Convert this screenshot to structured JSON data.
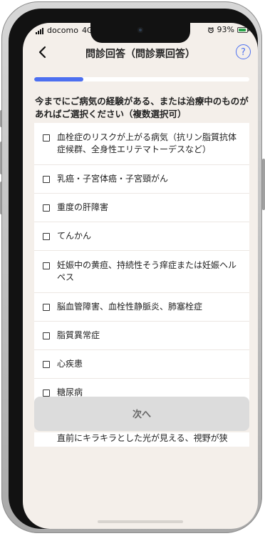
{
  "status_bar": {
    "carrier": "docomo",
    "network": "4G",
    "battery": "93%",
    "battery_level": 0.93,
    "alarm_icon": "alarm-icon"
  },
  "header": {
    "title": "問診回答（問診票回答）",
    "back_icon": "chevron-left-icon",
    "help_label": "?"
  },
  "progress": {
    "value": 0.23
  },
  "question": {
    "text": "今までにご病気の経験がある、または治療中のものがあればご選択ください（複数選択可）"
  },
  "options": [
    "血栓症のリスクが上がる病気（抗リン脂質抗体症候群、全身性エリテマトーデスなど）",
    "乳癌・子宮体癌・子宮頸がん",
    "重度の肝障害",
    "てんかん",
    "妊娠中の黄疸、持続性そう痒症または妊娠ヘルペス",
    "脳血管障害、血栓性静脈炎、肺塞栓症",
    "脂質異常症",
    "心疾患",
    "糖尿病",
    "直前にキラキラとした光が見える、視野が狭"
  ],
  "actions": {
    "next_label": "次へ"
  },
  "colors": {
    "accent": "#4c6ff0",
    "background": "#f4efea",
    "button_disabled": "#dcdcdc"
  }
}
